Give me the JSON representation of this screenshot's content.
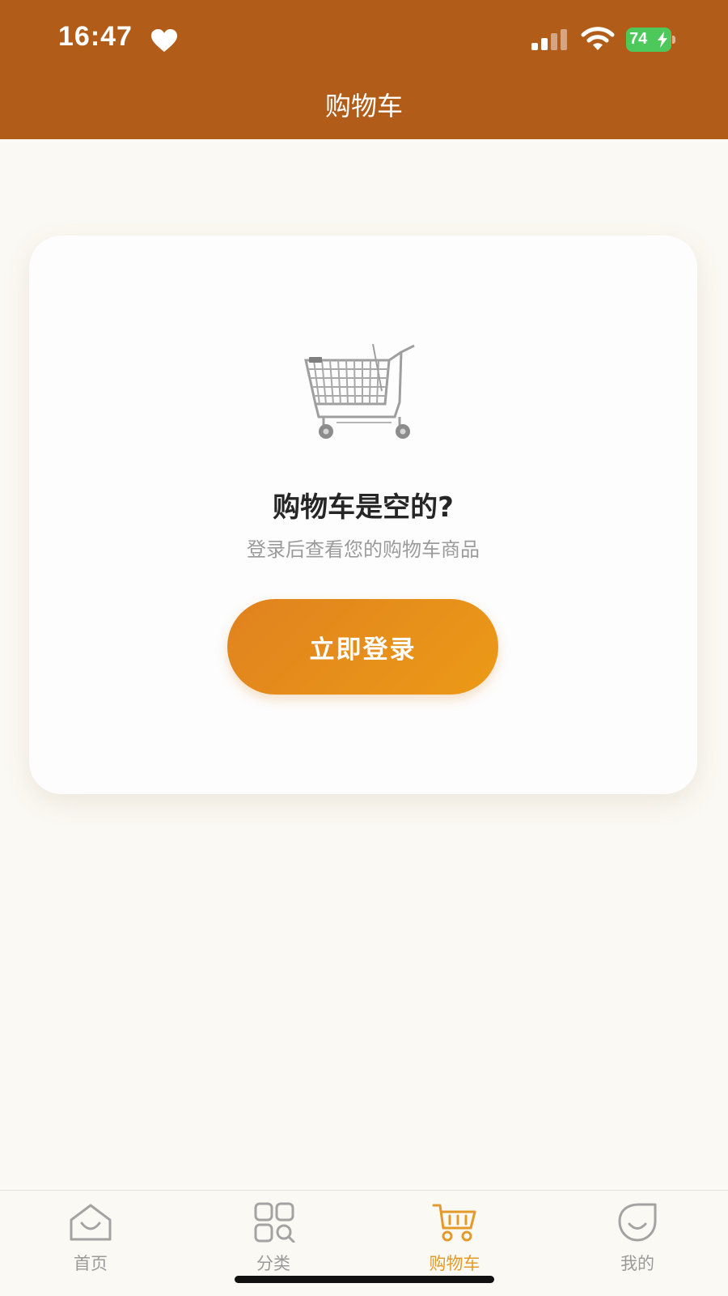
{
  "status_bar": {
    "time": "16:47",
    "battery_level": "74",
    "icons": [
      "heart-icon",
      "signal-icon",
      "wifi-icon",
      "battery-icon"
    ]
  },
  "header": {
    "title": "购物车"
  },
  "empty_state": {
    "illustration": "shopping-cart-icon",
    "title": "购物车是空的?",
    "subtitle": "登录后查看您的购物车商品",
    "login_button_label": "立即登录"
  },
  "tabbar": {
    "active_index": 2,
    "items": [
      {
        "label": "首页",
        "icon": "home-icon"
      },
      {
        "label": "分类",
        "icon": "category-icon"
      },
      {
        "label": "购物车",
        "icon": "cart-icon"
      },
      {
        "label": "我的",
        "icon": "profile-icon"
      }
    ]
  },
  "colors": {
    "header_background": "#b25c1a",
    "page_background": "#fbf9f3",
    "button_gradient_start": "#e0821f",
    "button_gradient_end": "#ec9a17",
    "active_tab": "#e49a2a",
    "inactive_tab": "#9a9a9a",
    "battery_green": "#4cc95a"
  }
}
